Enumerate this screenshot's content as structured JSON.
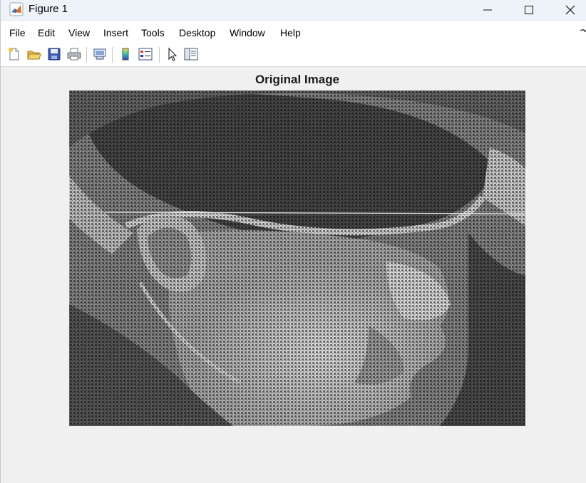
{
  "window": {
    "title": "Figure 1"
  },
  "menu": {
    "items": [
      "File",
      "Edit",
      "View",
      "Insert",
      "Tools",
      "Desktop",
      "Window",
      "Help"
    ]
  },
  "toolbar": {
    "tools": [
      "new-figure-icon",
      "open-file-icon",
      "save-icon",
      "print-icon",
      "link-plot-icon",
      "insert-colorbar-icon",
      "insert-legend-icon",
      "edit-plot-pointer-icon",
      "property-inspector-icon"
    ]
  },
  "axes": {
    "title": "Original Image"
  },
  "image": {
    "description_colors": {
      "light": "#e6e6e6",
      "dark": "#2a2a2a"
    }
  }
}
